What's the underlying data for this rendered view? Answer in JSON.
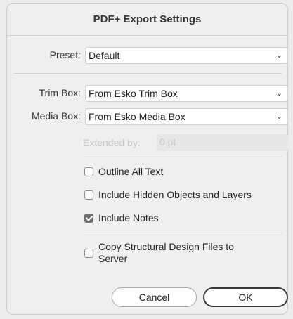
{
  "dialog": {
    "title": "PDF+ Export Settings"
  },
  "preset": {
    "label": "Preset:",
    "value": "Default"
  },
  "trim_box": {
    "label": "Trim Box:",
    "value": "From Esko Trim Box"
  },
  "media_box": {
    "label": "Media Box:",
    "value": "From Esko Media Box"
  },
  "extended": {
    "label": "Extended by:",
    "value": "0 pt"
  },
  "options": [
    {
      "label": "Outline All Text",
      "checked": false
    },
    {
      "label": "Include Hidden Objects and Layers",
      "checked": false
    },
    {
      "label": "Include Notes",
      "checked": true
    }
  ],
  "copy_structural": {
    "label_line1": "Copy Structural Design Files to",
    "label_line2": "Server",
    "checked": false
  },
  "buttons": {
    "cancel": "Cancel",
    "ok": "OK"
  },
  "icons": {
    "dropdown": "chevron-down-icon",
    "checkmark": "checkmark-icon"
  }
}
